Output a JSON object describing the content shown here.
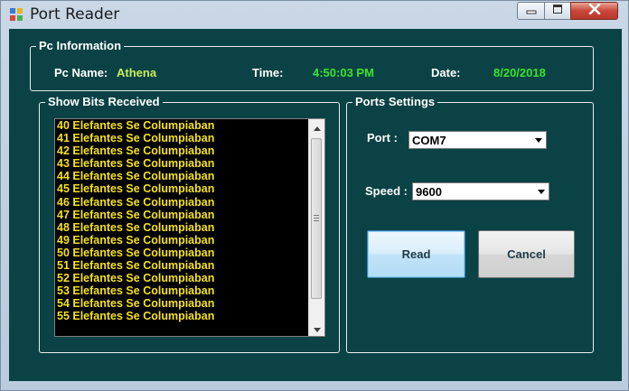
{
  "window": {
    "title": "Port Reader"
  },
  "pc_info": {
    "legend": "Pc Information",
    "name_label": "Pc Name:",
    "name_value": "Athena",
    "time_label": "Time:",
    "time_value": "4:50:03 PM",
    "date_label": "Date:",
    "date_value": "8/20/2018"
  },
  "bits": {
    "legend": "Show Bits Received",
    "items": [
      "40  Elefantes Se Columpiaban",
      "41  Elefantes Se Columpiaban",
      "42  Elefantes Se Columpiaban",
      "43  Elefantes Se Columpiaban",
      "44  Elefantes Se Columpiaban",
      "45  Elefantes Se Columpiaban",
      "46  Elefantes Se Columpiaban",
      "47  Elefantes Se Columpiaban",
      "48  Elefantes Se Columpiaban",
      "49  Elefantes Se Columpiaban",
      "50  Elefantes Se Columpiaban",
      "51  Elefantes Se Columpiaban",
      "52  Elefantes Se Columpiaban",
      "53  Elefantes Se Columpiaban",
      "54  Elefantes Se Columpiaban",
      "55  Elefantes Se Columpiaban"
    ]
  },
  "ports": {
    "legend": "Ports Settings",
    "port_label": "Port :",
    "port_value": "COM7",
    "speed_label": "Speed :",
    "speed_value": "9600",
    "read_label": "Read",
    "cancel_label": "Cancel"
  },
  "colors": {
    "client_background": "#0b4245",
    "pc_name_value": "#c9ef5a",
    "time_date_value": "#39e32f",
    "list_text": "#f5e11b"
  }
}
